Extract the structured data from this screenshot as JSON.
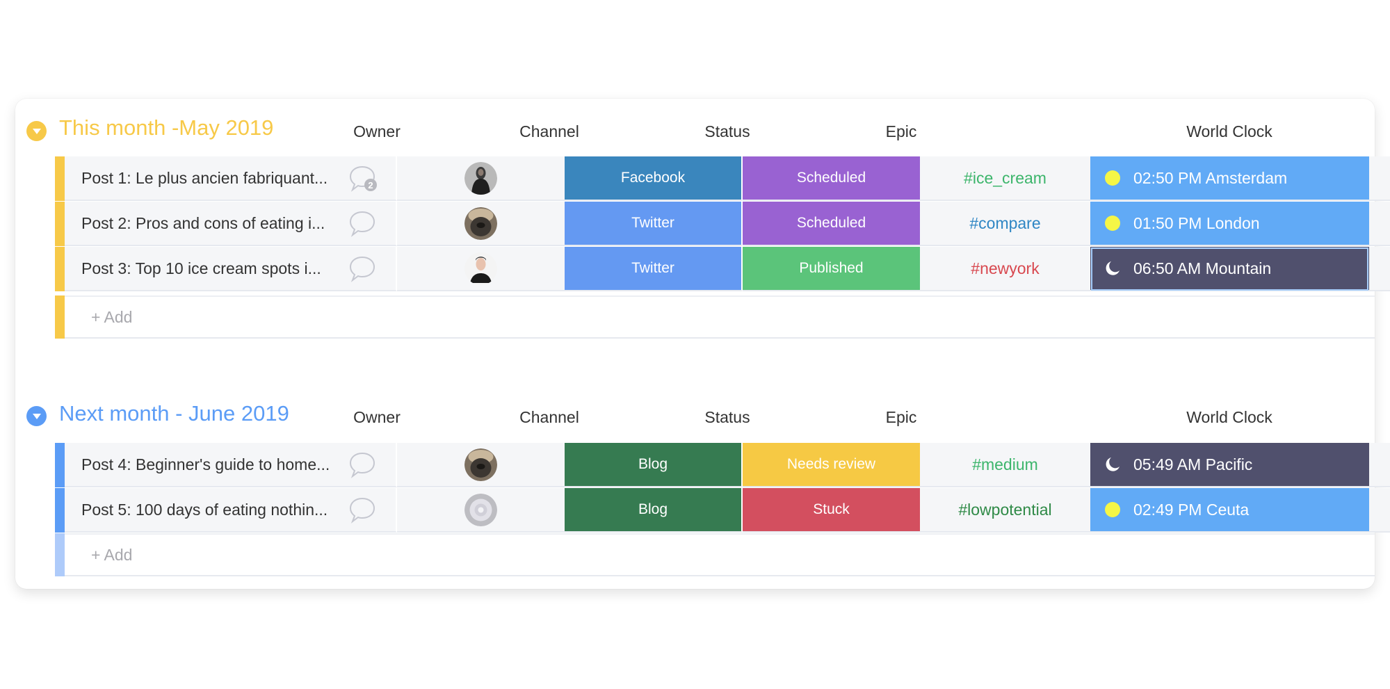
{
  "columns": {
    "owner": "Owner",
    "channel": "Channel",
    "status": "Status",
    "epic": "Epic",
    "world_clock": "World Clock"
  },
  "colors": {
    "group1_accent": "#f7c948",
    "group2_accent": "#5b9cf6",
    "group2_add_bar": "#aecbfa",
    "channel_facebook": "#3a86bd",
    "channel_twitter": "#6499f2",
    "channel_blog": "#367b51",
    "status_scheduled": "#9962d2",
    "status_published": "#5bc47a",
    "status_needs_review": "#f6c944",
    "status_stuck": "#d34f5f",
    "clock_day": "#61aaf6",
    "clock_night": "#50506d",
    "epic_green": "#3cb56b",
    "epic_blue": "#2f86c4",
    "epic_red": "#d8484f",
    "epic_darkgreen": "#2f8a47"
  },
  "groups": [
    {
      "title": "This month -May 2019",
      "add_label": "+ Add",
      "rows": [
        {
          "name": "Post 1: Le plus ancien fabriquant...",
          "comments": "2",
          "owner": "avatar-woman",
          "channel": "Facebook",
          "status": "Scheduled",
          "epic": "#ice_cream",
          "clock_icon": "sun-icon",
          "clock": "02:50 PM Amsterdam"
        },
        {
          "name": "Post 2: Pros and cons of eating i...",
          "comments": "",
          "owner": "avatar-pug",
          "channel": "Twitter",
          "status": "Scheduled",
          "epic": "#compare",
          "clock_icon": "sun-icon",
          "clock": "01:50 PM London"
        },
        {
          "name": "Post 3: Top 10 ice cream spots i...",
          "comments": "",
          "owner": "avatar-man",
          "channel": "Twitter",
          "status": "Published",
          "epic": "#newyork",
          "clock_icon": "moon-icon",
          "clock": "06:50 AM Mountain"
        }
      ]
    },
    {
      "title": "Next month - June 2019",
      "add_label": "+ Add",
      "rows": [
        {
          "name": "Post 4: Beginner's guide to home...",
          "comments": "",
          "owner": "avatar-pug",
          "channel": "Blog",
          "status": "Needs review",
          "epic": "#medium",
          "clock_icon": "moon-icon",
          "clock": "05:49 AM Pacific"
        },
        {
          "name": "Post 5: 100 days of eating nothin...",
          "comments": "",
          "owner": "avatar-flower",
          "channel": "Blog",
          "status": "Stuck",
          "epic": "#lowpotential",
          "clock_icon": "sun-icon",
          "clock": "02:49 PM Ceuta"
        }
      ]
    }
  ]
}
